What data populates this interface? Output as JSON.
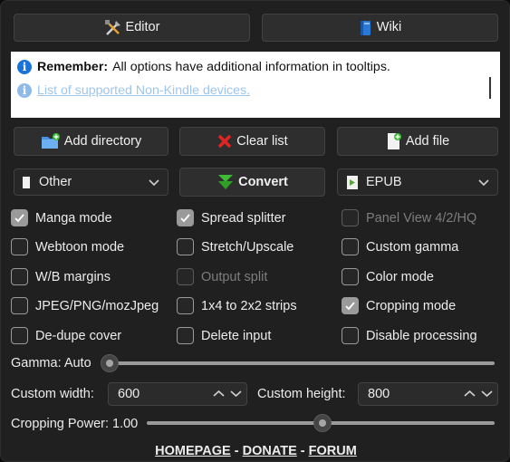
{
  "toolbar": {
    "editor_label": "Editor",
    "wiki_label": "Wiki"
  },
  "info": {
    "remember_bold": "Remember:",
    "remember_text": "All options have additional information in tooltips.",
    "link_text": "List of supported Non-Kindle devices."
  },
  "actions": {
    "add_directory": "Add directory",
    "clear_list": "Clear list",
    "add_file": "Add file"
  },
  "device_select": {
    "value": "Other"
  },
  "convert_label": "Convert",
  "format_select": {
    "value": "EPUB"
  },
  "options": {
    "manga_mode": "Manga mode",
    "spread_splitter": "Spread splitter",
    "panel_view": "Panel View 4/2/HQ",
    "webtoon_mode": "Webtoon mode",
    "stretch_upscale": "Stretch/Upscale",
    "custom_gamma": "Custom gamma",
    "wb_margins": "W/B margins",
    "output_split": "Output split",
    "color_mode": "Color mode",
    "jpeg_png": "JPEG/PNG/mozJpeg",
    "strips": "1x4 to 2x2 strips",
    "cropping_mode": "Cropping mode",
    "dedupe_cover": "De-dupe cover",
    "delete_input": "Delete input",
    "disable_processing": "Disable processing"
  },
  "gamma": {
    "label": "Gamma: Auto",
    "level": 0
  },
  "custom_width": {
    "label": "Custom width:",
    "value": "600"
  },
  "custom_height": {
    "label": "Custom height:",
    "value": "800"
  },
  "cropping_power": {
    "label": "Cropping Power: 1.00",
    "level": 0.5
  },
  "footer": {
    "homepage": "HOMEPAGE",
    "sep1": " - ",
    "donate": "DONATE",
    "sep2": " - ",
    "forum": "FORUM"
  },
  "colors": {
    "background": "#202020",
    "button": "#2e2e2e",
    "info_icon": "#1a73d8",
    "link": "#9ec5ec",
    "clear_red": "#e02424",
    "convert_green": "#3dbb34"
  }
}
